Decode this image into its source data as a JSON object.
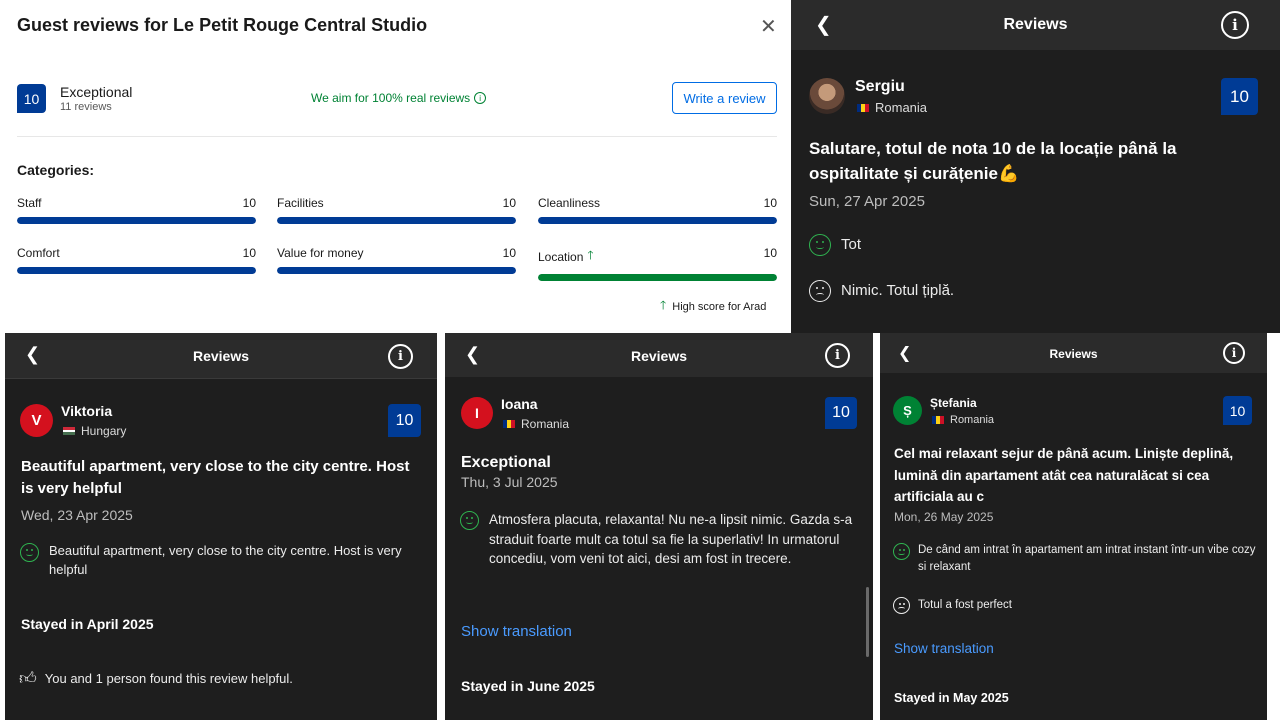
{
  "modal": {
    "title": "Guest reviews for Le Petit Rouge Central Studio",
    "close": "✕",
    "score": "10",
    "rating_word": "Exceptional",
    "reviews_count": "11 reviews",
    "aim_text": "We aim for 100% real reviews",
    "write_review": "Write a review",
    "categories_title": "Categories:",
    "categories": [
      {
        "label": "Staff",
        "score": "10",
        "fill": 1.0
      },
      {
        "label": "Facilities",
        "score": "10",
        "fill": 1.0
      },
      {
        "label": "Cleanliness",
        "score": "10",
        "fill": 1.0
      },
      {
        "label": "Comfort",
        "score": "10",
        "fill": 1.0
      },
      {
        "label": "Value for money",
        "score": "10",
        "fill": 1.0
      },
      {
        "label": "Location",
        "score": "10",
        "fill": 1.0,
        "highlight": true
      }
    ],
    "high_score": "High score for Arad",
    "accent": "#003b95",
    "green": "#008234"
  },
  "review_sergiu": {
    "header": "Reviews",
    "name": "Sergiu",
    "country": "Romania",
    "score": "10",
    "title": "Salutare, totul de nota 10 de la locație până la ospitalitate și curățenie💪",
    "date": "Sun, 27 Apr 2025",
    "positive": "Tot",
    "negative": "Nimic. Totul țiplă."
  },
  "review_viktoria": {
    "header": "Reviews",
    "initial": "V",
    "name": "Viktoria",
    "country": "Hungary",
    "score": "10",
    "title": "Beautiful apartment, very close to the city centre. Host is very helpful",
    "date": "Wed, 23 Apr 2025",
    "positive": "Beautiful apartment, very close to the city centre. Host is very helpful",
    "stayed": "Stayed in April 2025",
    "helpful": "You and 1 person found this review helpful."
  },
  "review_ioana": {
    "header": "Reviews",
    "initial": "I",
    "name": "Ioana",
    "country": "Romania",
    "score": "10",
    "title": "Exceptional",
    "date": "Thu, 3 Jul 2025",
    "positive": "Atmosfera placuta, relaxanta! Nu ne-a lipsit nimic. Gazda s-a straduit foarte mult ca totul sa fie la superlativ! In urmatorul concediu, vom veni tot aici, desi am fost in trecere.",
    "translation": "Show translation",
    "stayed": "Stayed in June 2025"
  },
  "review_stefania": {
    "header": "Reviews",
    "initial": "Ș",
    "name": "Ștefania",
    "country": "Romania",
    "score": "10",
    "title": "Cel mai relaxant sejur de până acum. Liniște deplină, lumină din apartament atât cea naturalăcat si cea artificiala au c",
    "date": "Mon, 26 May 2025",
    "positive": "De când am intrat în apartament am intrat instant  într-un vibe cozy si relaxant",
    "negative": "Totul a fost perfect",
    "translation": "Show translation",
    "stayed": "Stayed in May 2025"
  }
}
